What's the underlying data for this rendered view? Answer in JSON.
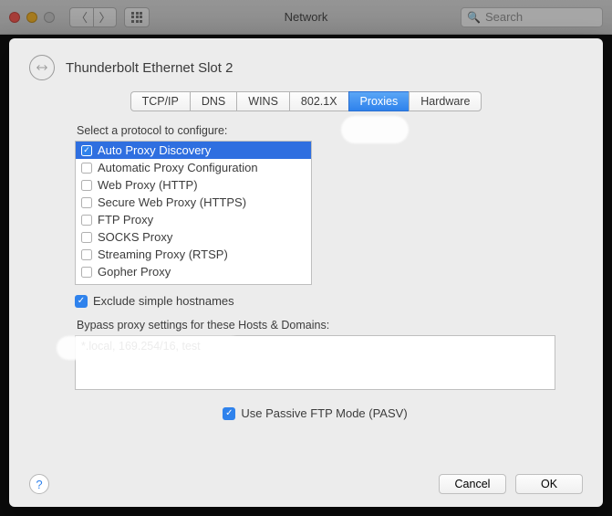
{
  "window": {
    "title": "Network"
  },
  "search": {
    "placeholder": "Search"
  },
  "interface": {
    "title": "Thunderbolt Ethernet Slot 2"
  },
  "tabs": [
    {
      "label": "TCP/IP",
      "selected": false
    },
    {
      "label": "DNS",
      "selected": false
    },
    {
      "label": "WINS",
      "selected": false
    },
    {
      "label": "802.1X",
      "selected": false
    },
    {
      "label": "Proxies",
      "selected": true
    },
    {
      "label": "Hardware",
      "selected": false
    }
  ],
  "protocols": {
    "label": "Select a protocol to configure:",
    "items": [
      {
        "label": "Auto Proxy Discovery",
        "checked": true,
        "selected": true
      },
      {
        "label": "Automatic Proxy Configuration",
        "checked": false,
        "selected": false
      },
      {
        "label": "Web Proxy (HTTP)",
        "checked": false,
        "selected": false
      },
      {
        "label": "Secure Web Proxy (HTTPS)",
        "checked": false,
        "selected": false
      },
      {
        "label": "FTP Proxy",
        "checked": false,
        "selected": false
      },
      {
        "label": "SOCKS Proxy",
        "checked": false,
        "selected": false
      },
      {
        "label": "Streaming Proxy (RTSP)",
        "checked": false,
        "selected": false
      },
      {
        "label": "Gopher Proxy",
        "checked": false,
        "selected": false
      }
    ]
  },
  "exclude_simple": {
    "label": "Exclude simple hostnames",
    "checked": true
  },
  "bypass": {
    "label": "Bypass proxy settings for these Hosts & Domains:",
    "value": "*.local, 169.254/16, test"
  },
  "passive_ftp": {
    "label": "Use Passive FTP Mode (PASV)",
    "checked": true
  },
  "buttons": {
    "cancel": "Cancel",
    "ok": "OK"
  }
}
